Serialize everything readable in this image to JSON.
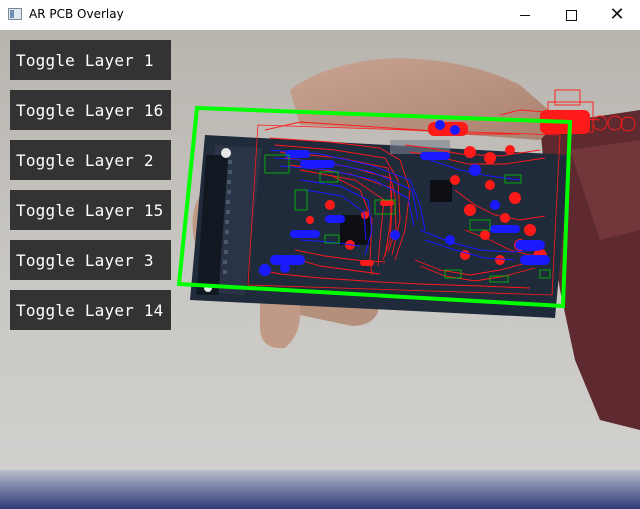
{
  "window": {
    "title": "AR PCB Overlay",
    "controls": {
      "minimize": "minimize-icon",
      "maximize": "maximize-icon",
      "close": "close-icon"
    }
  },
  "layer_buttons": [
    {
      "label": "Toggle Layer 1"
    },
    {
      "label": "Toggle Layer 16"
    },
    {
      "label": "Toggle Layer 2"
    },
    {
      "label": "Toggle Layer 15"
    },
    {
      "label": "Toggle Layer 3"
    },
    {
      "label": "Toggle Layer 14"
    }
  ],
  "colors": {
    "button_bg": "#333333",
    "button_text": "#ffffff",
    "detection_outline": "#00ff00",
    "top_layer_traces": "#ff1a1a",
    "bottom_layer_traces": "#1a1aff",
    "silkscreen": "#00cc00"
  }
}
